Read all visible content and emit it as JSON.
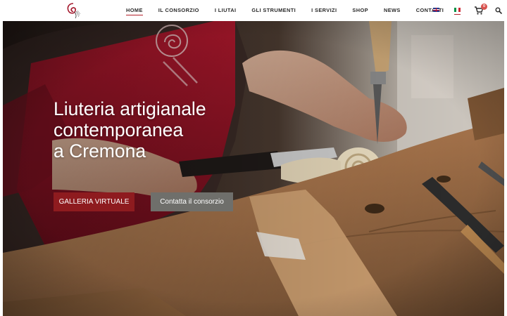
{
  "header": {
    "logo_icon": "violin-scroll-logo-icon",
    "nav": [
      {
        "label": "HOME",
        "active": true
      },
      {
        "label": "IL CONSORZIO",
        "active": false
      },
      {
        "label": "I LIUTAI",
        "active": false
      },
      {
        "label": "GLI STRUMENTI",
        "active": false
      },
      {
        "label": "I SERVIZI",
        "active": false
      },
      {
        "label": "SHOP",
        "active": false
      },
      {
        "label": "NEWS",
        "active": false
      },
      {
        "label": "CONTATTI",
        "active": false
      }
    ],
    "languages": [
      {
        "icon": "uk-flag-icon",
        "active": false
      },
      {
        "icon": "italy-flag-icon",
        "active": true
      }
    ],
    "cart": {
      "icon": "cart-icon",
      "count": "0"
    },
    "search_icon": "search-icon"
  },
  "hero": {
    "title_lines": [
      "Liuteria artigianale",
      "contemporanea",
      "a Cremona"
    ],
    "primary_button": "GALLERIA VIRTUALE",
    "secondary_button": "Contatta il consorzio",
    "image_subject": "luthier-carving-violin-scroll-photo"
  },
  "colors": {
    "accent": "#b3202a",
    "primary_button": "#8e1b1f",
    "secondary_button": "#6f6f6b",
    "apron": "#a3162a",
    "wood": "#b58357"
  }
}
